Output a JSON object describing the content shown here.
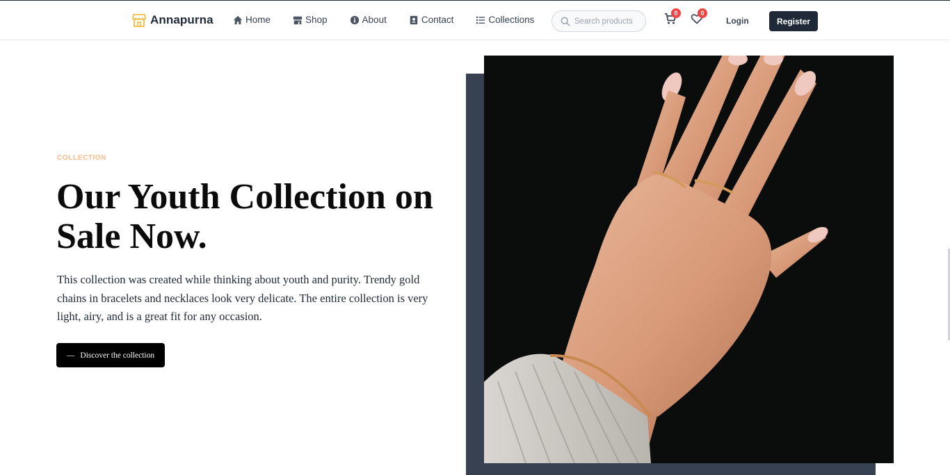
{
  "brand": {
    "name": "Annapurna",
    "icon": "store-icon"
  },
  "nav": {
    "links": [
      {
        "label": "Home",
        "icon": "home-icon"
      },
      {
        "label": "Shop",
        "icon": "shop-icon"
      },
      {
        "label": "About",
        "icon": "info-icon"
      },
      {
        "label": "Contact",
        "icon": "contact-icon"
      },
      {
        "label": "Collections",
        "icon": "list-icon"
      }
    ],
    "search_placeholder": "Search products",
    "cart_count": "0",
    "wishlist_count": "0",
    "login_label": "Login",
    "register_label": "Register"
  },
  "hero": {
    "eyebrow": "COLLECTION",
    "headline": "Our Youth Collection on Sale Now.",
    "description": "This collection was created while thinking about youth and purity. Trendy gold chains in bracelets and necklaces look very delicate. The entire collection is very light, airy, and is a great fit for any occasion.",
    "cta_label": "Discover the collection",
    "cta_prefix": "—"
  },
  "colors": {
    "accent": "#fdba8c",
    "dark": "#1f2937",
    "backdrop": "#374151",
    "badge": "#ef4444"
  }
}
